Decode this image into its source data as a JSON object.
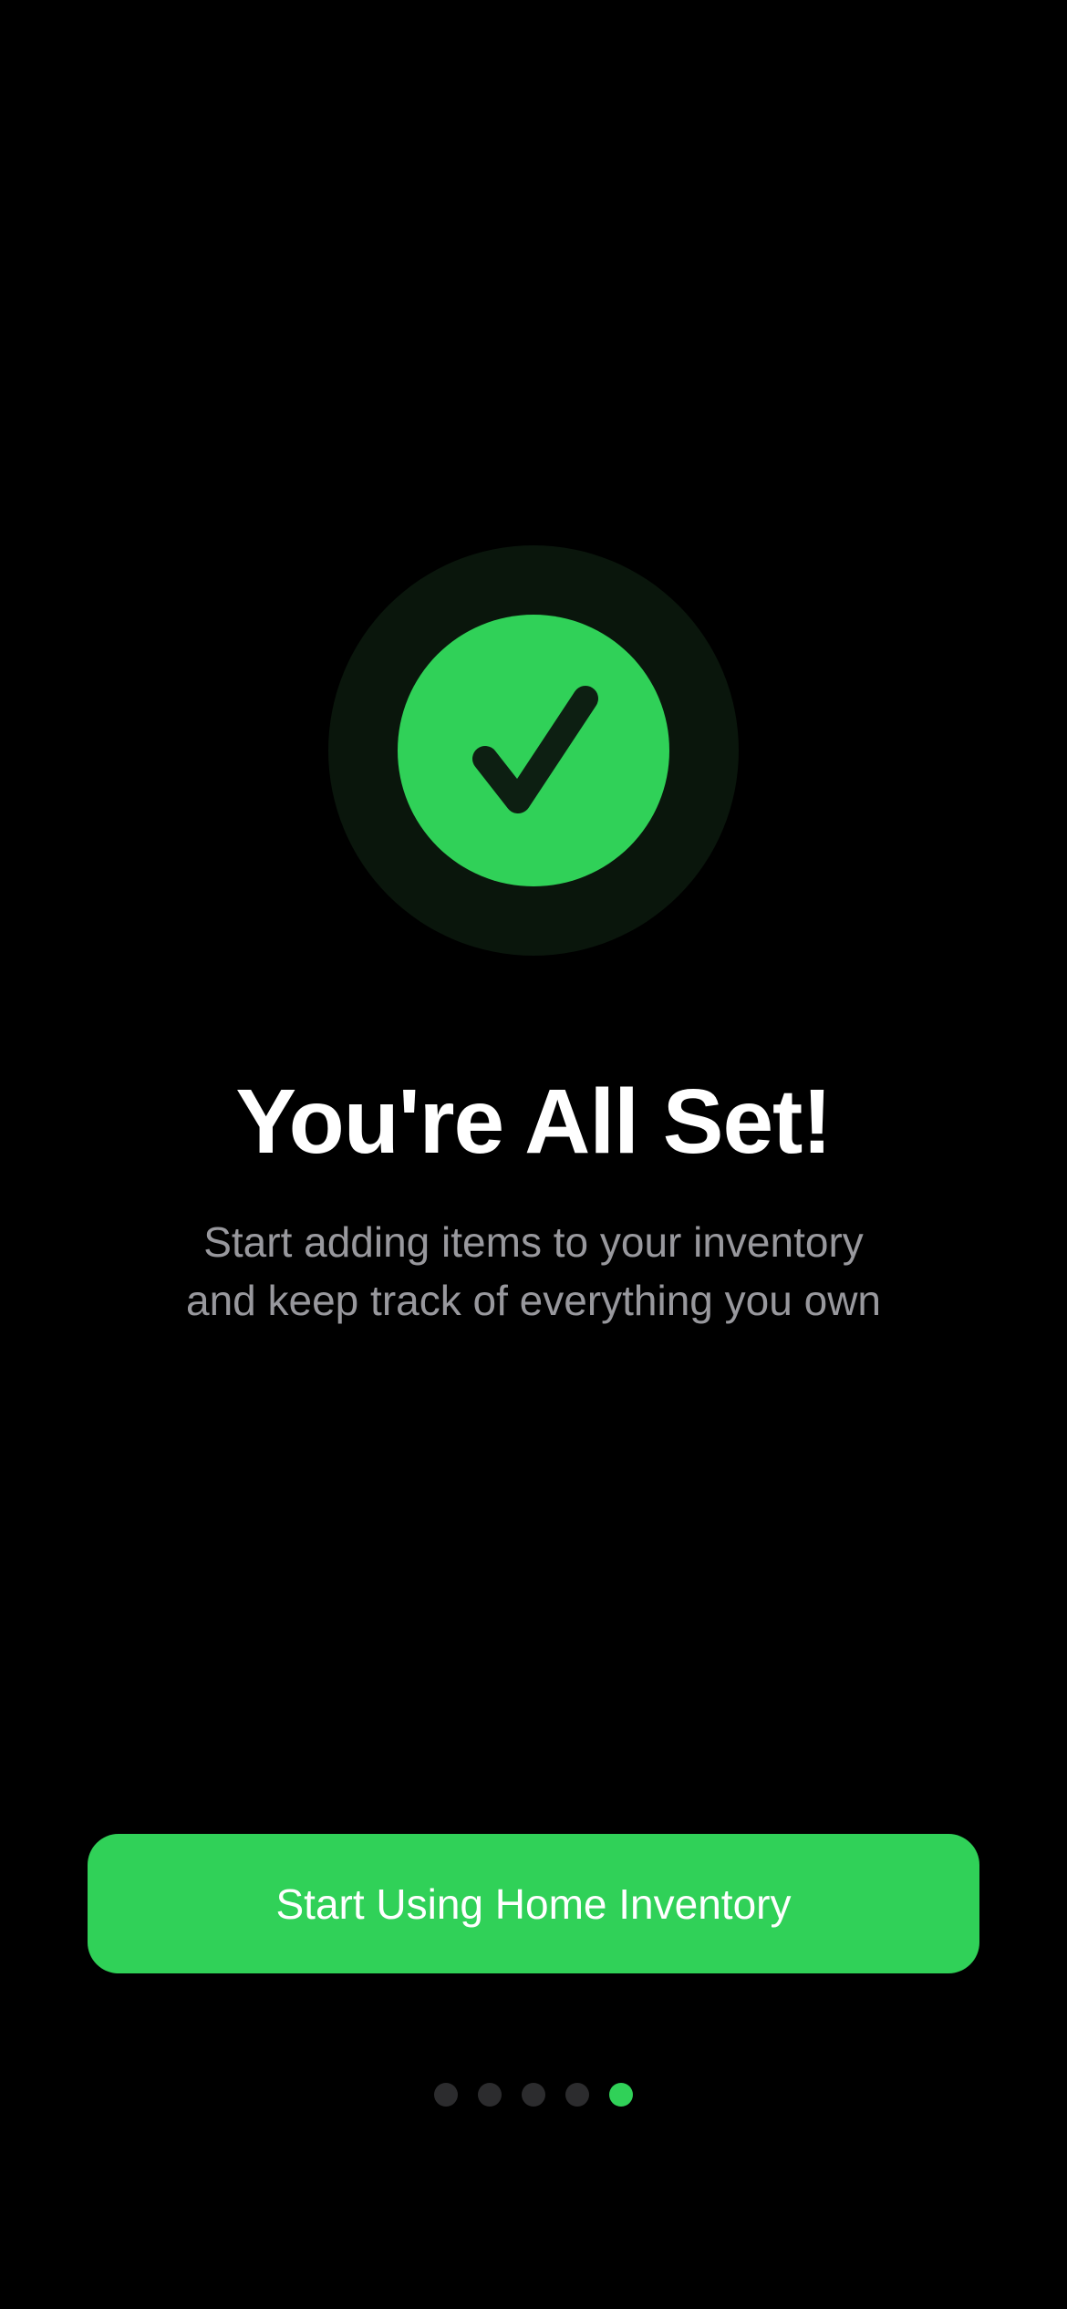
{
  "onboarding": {
    "title": "You're All Set!",
    "subtitle_lines": [
      "Start adding items to your inventory",
      "and keep track of everything you own"
    ],
    "primary_button_label": "Start Using Home Inventory",
    "page_indicator": {
      "total_pages": 5,
      "current_page": 5
    },
    "success_icon": "checkmark-icon"
  },
  "colors": {
    "background": "#000000",
    "accent": "#30d158",
    "accent_halo": "#0a160c",
    "title_text": "#ffffff",
    "subtitle_text": "#98989d",
    "inactive_dot": "#2c2c2e",
    "checkmark": "#0d1f12"
  }
}
